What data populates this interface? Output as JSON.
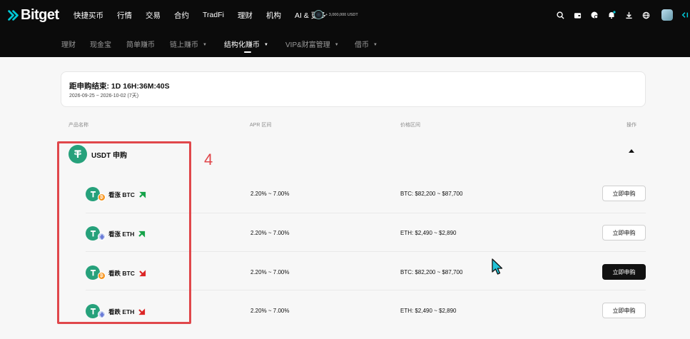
{
  "brand": {
    "name": "Bitget"
  },
  "main_nav": [
    "快捷买币",
    "行情",
    "交易",
    "合约",
    "TradFi",
    "理财",
    "机构",
    "AI & 更多"
  ],
  "promo": {
    "text": "+ 3,000,000 USDT"
  },
  "sub_nav": [
    {
      "label": "理财"
    },
    {
      "label": "现金宝"
    },
    {
      "label": "简单赚币"
    },
    {
      "label": "链上赚币",
      "caret": "▼"
    },
    {
      "label": "结构化赚币",
      "caret": "▼"
    },
    {
      "label": "VIP&财富管理",
      "caret": "▼"
    },
    {
      "label": "借币",
      "caret": "▼"
    }
  ],
  "countdown": {
    "label": "距申购结束:  1D 16H:36M:40S",
    "range": "2026-09-25 ~ 2026-10-02 (7天)"
  },
  "table": {
    "headers": {
      "product": "产品名称",
      "apr": "APR 区间",
      "price": "价格区间",
      "action": "操作"
    },
    "group_title": "USDT 申购",
    "rows": [
      {
        "name": "看涨 BTC",
        "coin": "btc",
        "trend": "up",
        "apr": "2.20% ~ 7.00%",
        "price": "BTC:  $82,200 ~ $87,700",
        "button": "立即申购",
        "highlighted": false
      },
      {
        "name": "看涨 ETH",
        "coin": "eth",
        "trend": "up",
        "apr": "2.20% ~ 7.00%",
        "price": "ETH:  $2,490 ~ $2,890",
        "button": "立即申购",
        "highlighted": false
      },
      {
        "name": "看跌 BTC",
        "coin": "btc",
        "trend": "down",
        "apr": "2.20% ~ 7.00%",
        "price": "BTC:  $82,200 ~ $87,700",
        "button": "立即申购",
        "highlighted": true
      },
      {
        "name": "看跌 ETH",
        "coin": "eth",
        "trend": "down",
        "apr": "2.20% ~ 7.00%",
        "price": "ETH:  $2,490 ~ $2,890",
        "button": "立即申购",
        "highlighted": false
      }
    ]
  },
  "annotation": {
    "number": "4",
    "color": "#e0474b"
  },
  "colors": {
    "up": "#16a34a",
    "down": "#dc2626",
    "usdt": "#26a17b",
    "btc": "#f7931a"
  }
}
